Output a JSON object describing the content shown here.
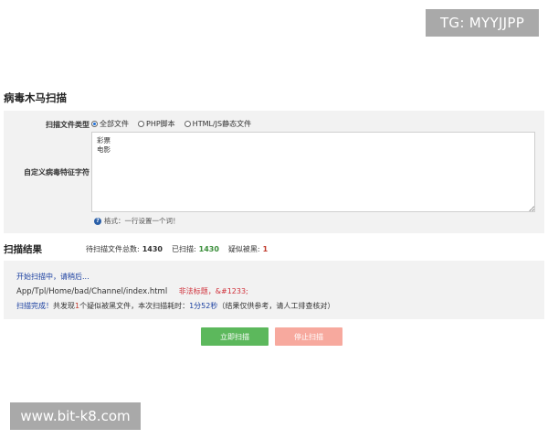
{
  "watermarks": {
    "tg": "TG: MYYJJPP",
    "site": "www.bit-k8.com"
  },
  "page": {
    "title": "病毒木马扫描"
  },
  "form": {
    "type_label": "扫描文件类型",
    "type_options": [
      {
        "label": "全部文件",
        "selected": true
      },
      {
        "label": "PHP脚本",
        "selected": false
      },
      {
        "label": "HTML/JS静态文件",
        "selected": false
      }
    ],
    "custom_label": "自定义病毒特征字符",
    "custom_value": "彩票\n电影",
    "hint": "格式：一行设置一个词！",
    "help_icon": "question-circle-icon"
  },
  "results": {
    "title": "扫描结果",
    "total_label": "待扫描文件总数:",
    "total_value": "1430",
    "scanned_label": "已扫描:",
    "scanned_value": "1430",
    "suspect_label": "疑似被黑:",
    "suspect_value": "1"
  },
  "log": {
    "start": "开始扫描中，请稍后...",
    "file_path": "App/Tpl/Home/bad/Channel/index.html",
    "warning": "非法标题，&#1233;",
    "done_label": "扫描完成！",
    "summary_prefix": "共发现",
    "count": "1",
    "summary_mid": "个疑似被黑文件，本次扫描耗时：",
    "elapsed": "1分52秒",
    "summary_suffix": "（结果仅供参考，请人工排查核对）"
  },
  "actions": {
    "start_label": "立即扫描",
    "stop_label": "停止扫描"
  },
  "colors": {
    "start_button": "#5cb85c",
    "stop_button": "#f7a99e",
    "panel_bg": "#f2f2f2"
  }
}
